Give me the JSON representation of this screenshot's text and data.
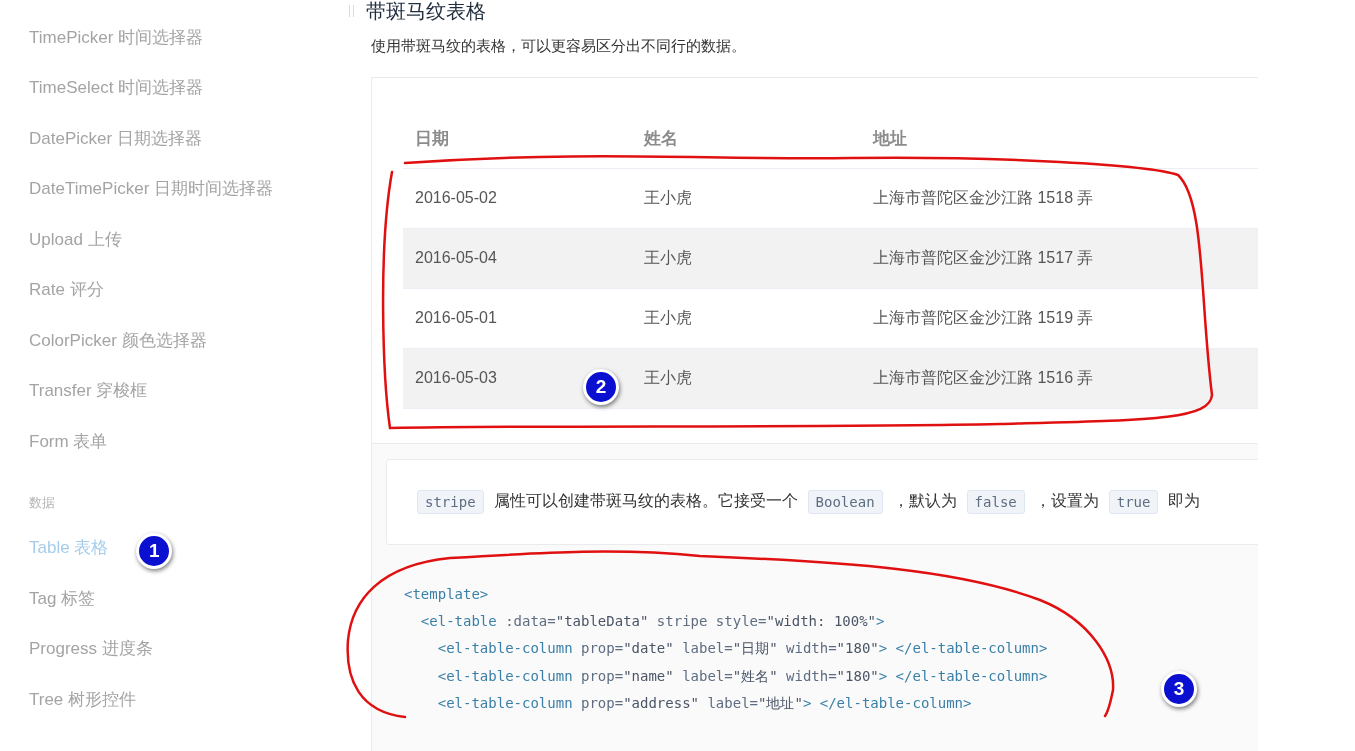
{
  "sidebar": {
    "items": [
      {
        "kind": "link",
        "label": "TimePicker 时间选择器",
        "selected": false
      },
      {
        "kind": "link",
        "label": "TimeSelect 时间选择器",
        "selected": false
      },
      {
        "kind": "link",
        "label": "DatePicker 日期选择器",
        "selected": false
      },
      {
        "kind": "link",
        "label": "DateTimePicker 日期时间选择器",
        "selected": false
      },
      {
        "kind": "link",
        "label": "Upload 上传",
        "selected": false
      },
      {
        "kind": "link",
        "label": "Rate 评分",
        "selected": false
      },
      {
        "kind": "link",
        "label": "ColorPicker 颜色选择器",
        "selected": false
      },
      {
        "kind": "link",
        "label": "Transfer 穿梭框",
        "selected": false
      },
      {
        "kind": "link",
        "label": "Form 表单",
        "selected": false
      },
      {
        "kind": "group",
        "label": "数据"
      },
      {
        "kind": "link",
        "label": "Table 表格",
        "selected": true,
        "badge": "1"
      },
      {
        "kind": "link",
        "label": "Tag 标签",
        "selected": false
      },
      {
        "kind": "link",
        "label": "Progress 进度条",
        "selected": false
      },
      {
        "kind": "link",
        "label": "Tree 树形控件",
        "selected": false
      }
    ]
  },
  "section": {
    "title": "带斑马纹表格",
    "description": "使用带斑马纹的表格，可以更容易区分出不同行的数据。"
  },
  "table": {
    "columns": [
      "日期",
      "姓名",
      "地址"
    ],
    "stripe": true,
    "badge": "2",
    "rows": [
      [
        "2016-05-02",
        "王小虎",
        "上海市普陀区金沙江路 1518 弄"
      ],
      [
        "2016-05-04",
        "王小虎",
        "上海市普陀区金沙江路 1517 弄"
      ],
      [
        "2016-05-01",
        "王小虎",
        "上海市普陀区金沙江路 1519 弄"
      ],
      [
        "2016-05-03",
        "王小虎",
        "上海市普陀区金沙江路 1516 弄"
      ]
    ]
  },
  "tip": [
    {
      "kind": "code",
      "text": "stripe"
    },
    {
      "kind": "text",
      "text": "属性可以创建带斑马纹的表格。它接受一个"
    },
    {
      "kind": "code",
      "text": "Boolean"
    },
    {
      "kind": "text",
      "text": "，默认为"
    },
    {
      "kind": "code",
      "text": "false"
    },
    {
      "kind": "text",
      "text": "，设置为"
    },
    {
      "kind": "code",
      "text": "true"
    },
    {
      "kind": "text",
      "text": "即为"
    }
  ],
  "code": {
    "badge": "3",
    "lines": [
      {
        "tokens": [
          {
            "kind": "tag",
            "text": "<template>"
          }
        ],
        "children": [
          {
            "tokens": [
              {
                "kind": "tag",
                "text": "<el-table"
              },
              {
                "kind": "attr",
                "text": " :data="
              },
              {
                "kind": "string",
                "text": "\"tableData\""
              },
              {
                "kind": "attr",
                "text": " stripe style="
              },
              {
                "kind": "string",
                "text": "\"width: 100%\""
              },
              {
                "kind": "tag",
                "text": ">"
              }
            ],
            "children": [
              {
                "tokens": [
                  {
                    "kind": "tag",
                    "text": "<el-table-column"
                  },
                  {
                    "kind": "attr",
                    "text": " prop="
                  },
                  {
                    "kind": "string",
                    "text": "\"date\""
                  },
                  {
                    "kind": "attr",
                    "text": " label="
                  },
                  {
                    "kind": "string",
                    "text": "\"日期\""
                  },
                  {
                    "kind": "attr",
                    "text": " width="
                  },
                  {
                    "kind": "string",
                    "text": "\"180\""
                  },
                  {
                    "kind": "tag",
                    "text": "> </el-table-column>"
                  }
                ]
              },
              {
                "tokens": [
                  {
                    "kind": "tag",
                    "text": "<el-table-column"
                  },
                  {
                    "kind": "attr",
                    "text": " prop="
                  },
                  {
                    "kind": "string",
                    "text": "\"name\""
                  },
                  {
                    "kind": "attr",
                    "text": " label="
                  },
                  {
                    "kind": "string",
                    "text": "\"姓名\""
                  },
                  {
                    "kind": "attr",
                    "text": " width="
                  },
                  {
                    "kind": "string",
                    "text": "\"180\""
                  },
                  {
                    "kind": "tag",
                    "text": "> </el-table-column>"
                  }
                ]
              },
              {
                "tokens": [
                  {
                    "kind": "tag",
                    "text": "<el-table-column"
                  },
                  {
                    "kind": "attr",
                    "text": " prop="
                  },
                  {
                    "kind": "string",
                    "text": "\"address\""
                  },
                  {
                    "kind": "attr",
                    "text": " label="
                  },
                  {
                    "kind": "string",
                    "text": "\"地址\""
                  },
                  {
                    "kind": "tag",
                    "text": "> </el-table-column>"
                  }
                ]
              }
            ]
          }
        ]
      }
    ]
  }
}
